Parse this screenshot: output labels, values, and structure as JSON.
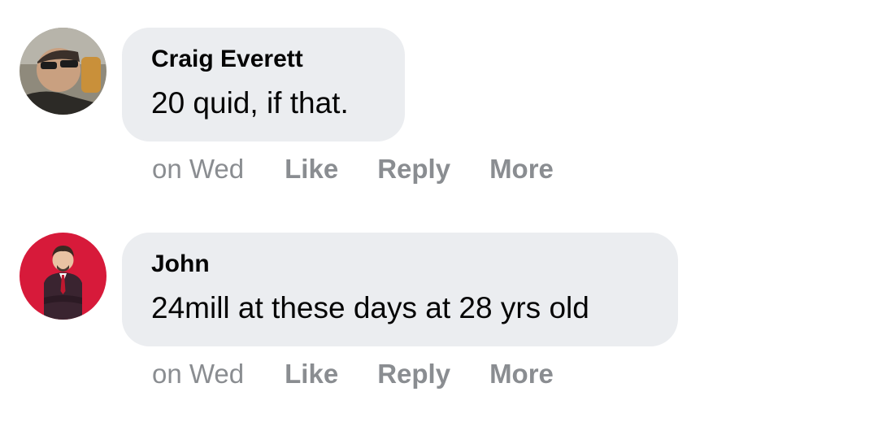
{
  "comments": [
    {
      "author": "Craig Everett",
      "text": "20 quid, if that.",
      "time": "on Wed",
      "actions": {
        "like": "Like",
        "reply": "Reply",
        "more": "More"
      }
    },
    {
      "author": "John",
      "text": "24mill at these days at 28 yrs old",
      "time": "on Wed",
      "actions": {
        "like": "Like",
        "reply": "Reply",
        "more": "More"
      }
    }
  ],
  "colors": {
    "bubble": "#ebedf0",
    "secondary_text": "#8a8d91",
    "primary_text": "#050505",
    "avatar2_background": "#d71a3a"
  }
}
